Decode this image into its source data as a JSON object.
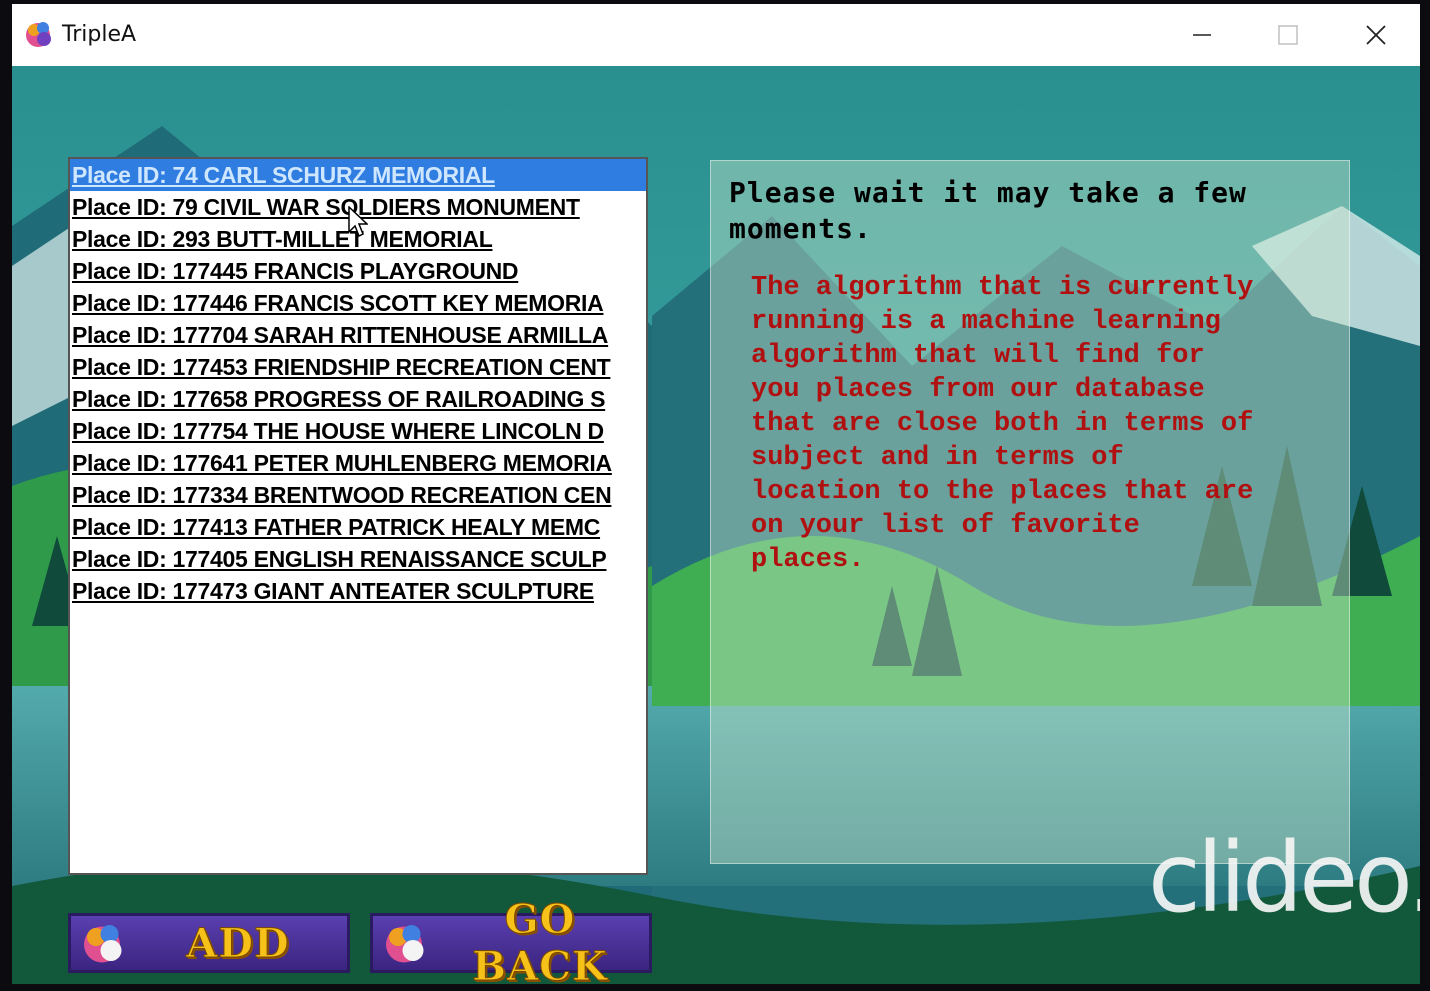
{
  "window": {
    "title": "TripleA"
  },
  "places": [
    "Place ID: 74 CARL SCHURZ MEMORIAL",
    "Place ID: 79 CIVIL WAR SOLDIERS MONUMENT",
    "Place ID: 293 BUTT-MILLET MEMORIAL",
    "Place ID: 177445 FRANCIS PLAYGROUND",
    "Place ID: 177446 FRANCIS SCOTT KEY MEMORIA",
    "Place ID: 177704 SARAH RITTENHOUSE ARMILLA",
    "Place ID: 177453 FRIENDSHIP RECREATION CENT",
    "Place ID: 177658 PROGRESS OF RAILROADING S",
    "Place ID: 177754 THE HOUSE WHERE LINCOLN D",
    "Place ID: 177641 PETER MUHLENBERG MEMORIA",
    "Place ID: 177334 BRENTWOOD RECREATION CEN",
    "Place ID: 177413 FATHER PATRICK HEALY MEMC",
    "Place ID: 177405 ENGLISH RENAISSANCE SCULP",
    "Place ID: 177473 GIANT ANTEATER SCULPTURE"
  ],
  "selected_index": 0,
  "panel": {
    "wait_message": "Please wait it may take a few moments.",
    "description": "The algorithm that is currently\nrunning is a machine learning\nalgorithm that will find for\nyou places from our database\nthat are close both in terms of\nsubject and in terms of\nlocation to the places that are\non your list of favorite\nplaces."
  },
  "buttons": {
    "add_label": "ADD",
    "back_label": "GO BACK"
  },
  "watermark": "clideo.",
  "colors": {
    "selection": "#2f7de0",
    "description_text": "#b01010",
    "button_text": "#f6c21a",
    "button_bg": "#4a30a0"
  }
}
